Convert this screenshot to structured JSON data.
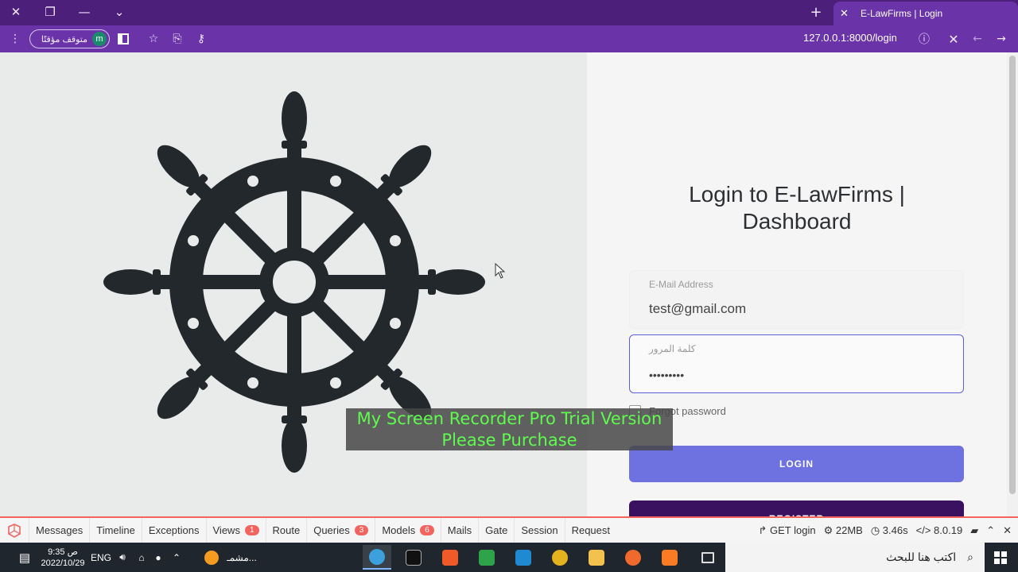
{
  "browser": {
    "tab_title": "E-LawFirms | Login",
    "url": "127.0.0.1:8000/login",
    "profile_label": "متوقف مؤقتًا",
    "profile_initial": "m"
  },
  "login": {
    "title_line1": "Login to E-LawFirms |",
    "title_line2": "Dashboard",
    "email_label": "E-Mail Address",
    "email_value": "test@gmail.com",
    "password_label": "كلمة المرور",
    "password_value": "•••••••••",
    "forgot_label": "Forgot password",
    "login_button": "LOGIN",
    "register_button": "REGISTER"
  },
  "watermark": {
    "line1": "My Screen Recorder Pro Trial Version",
    "line2": "Please Purchase"
  },
  "debugbar": {
    "tabs": [
      {
        "label": "Messages"
      },
      {
        "label": "Timeline"
      },
      {
        "label": "Exceptions"
      },
      {
        "label": "Views",
        "badge": "1"
      },
      {
        "label": "Route"
      },
      {
        "label": "Queries",
        "badge": "3"
      },
      {
        "label": "Models",
        "badge": "6"
      },
      {
        "label": "Mails"
      },
      {
        "label": "Gate"
      },
      {
        "label": "Session"
      },
      {
        "label": "Request"
      }
    ],
    "route": "GET login",
    "memory": "22MB",
    "time": "3.46s",
    "php_version": "8.0.19"
  },
  "taskbar": {
    "time": "9:35 ص",
    "date": "2022/10/29",
    "lang": "ENG",
    "weather": "مشمـ...",
    "search_placeholder": "اكتب هنا للبحث"
  },
  "colors": {
    "browser_frame": "#4b1f7a",
    "address_bar": "#6a34a8",
    "login_button": "#6e72e0",
    "register_button": "#3a1160",
    "debug_accent": "#f4645f",
    "wheel": "#23282d"
  }
}
